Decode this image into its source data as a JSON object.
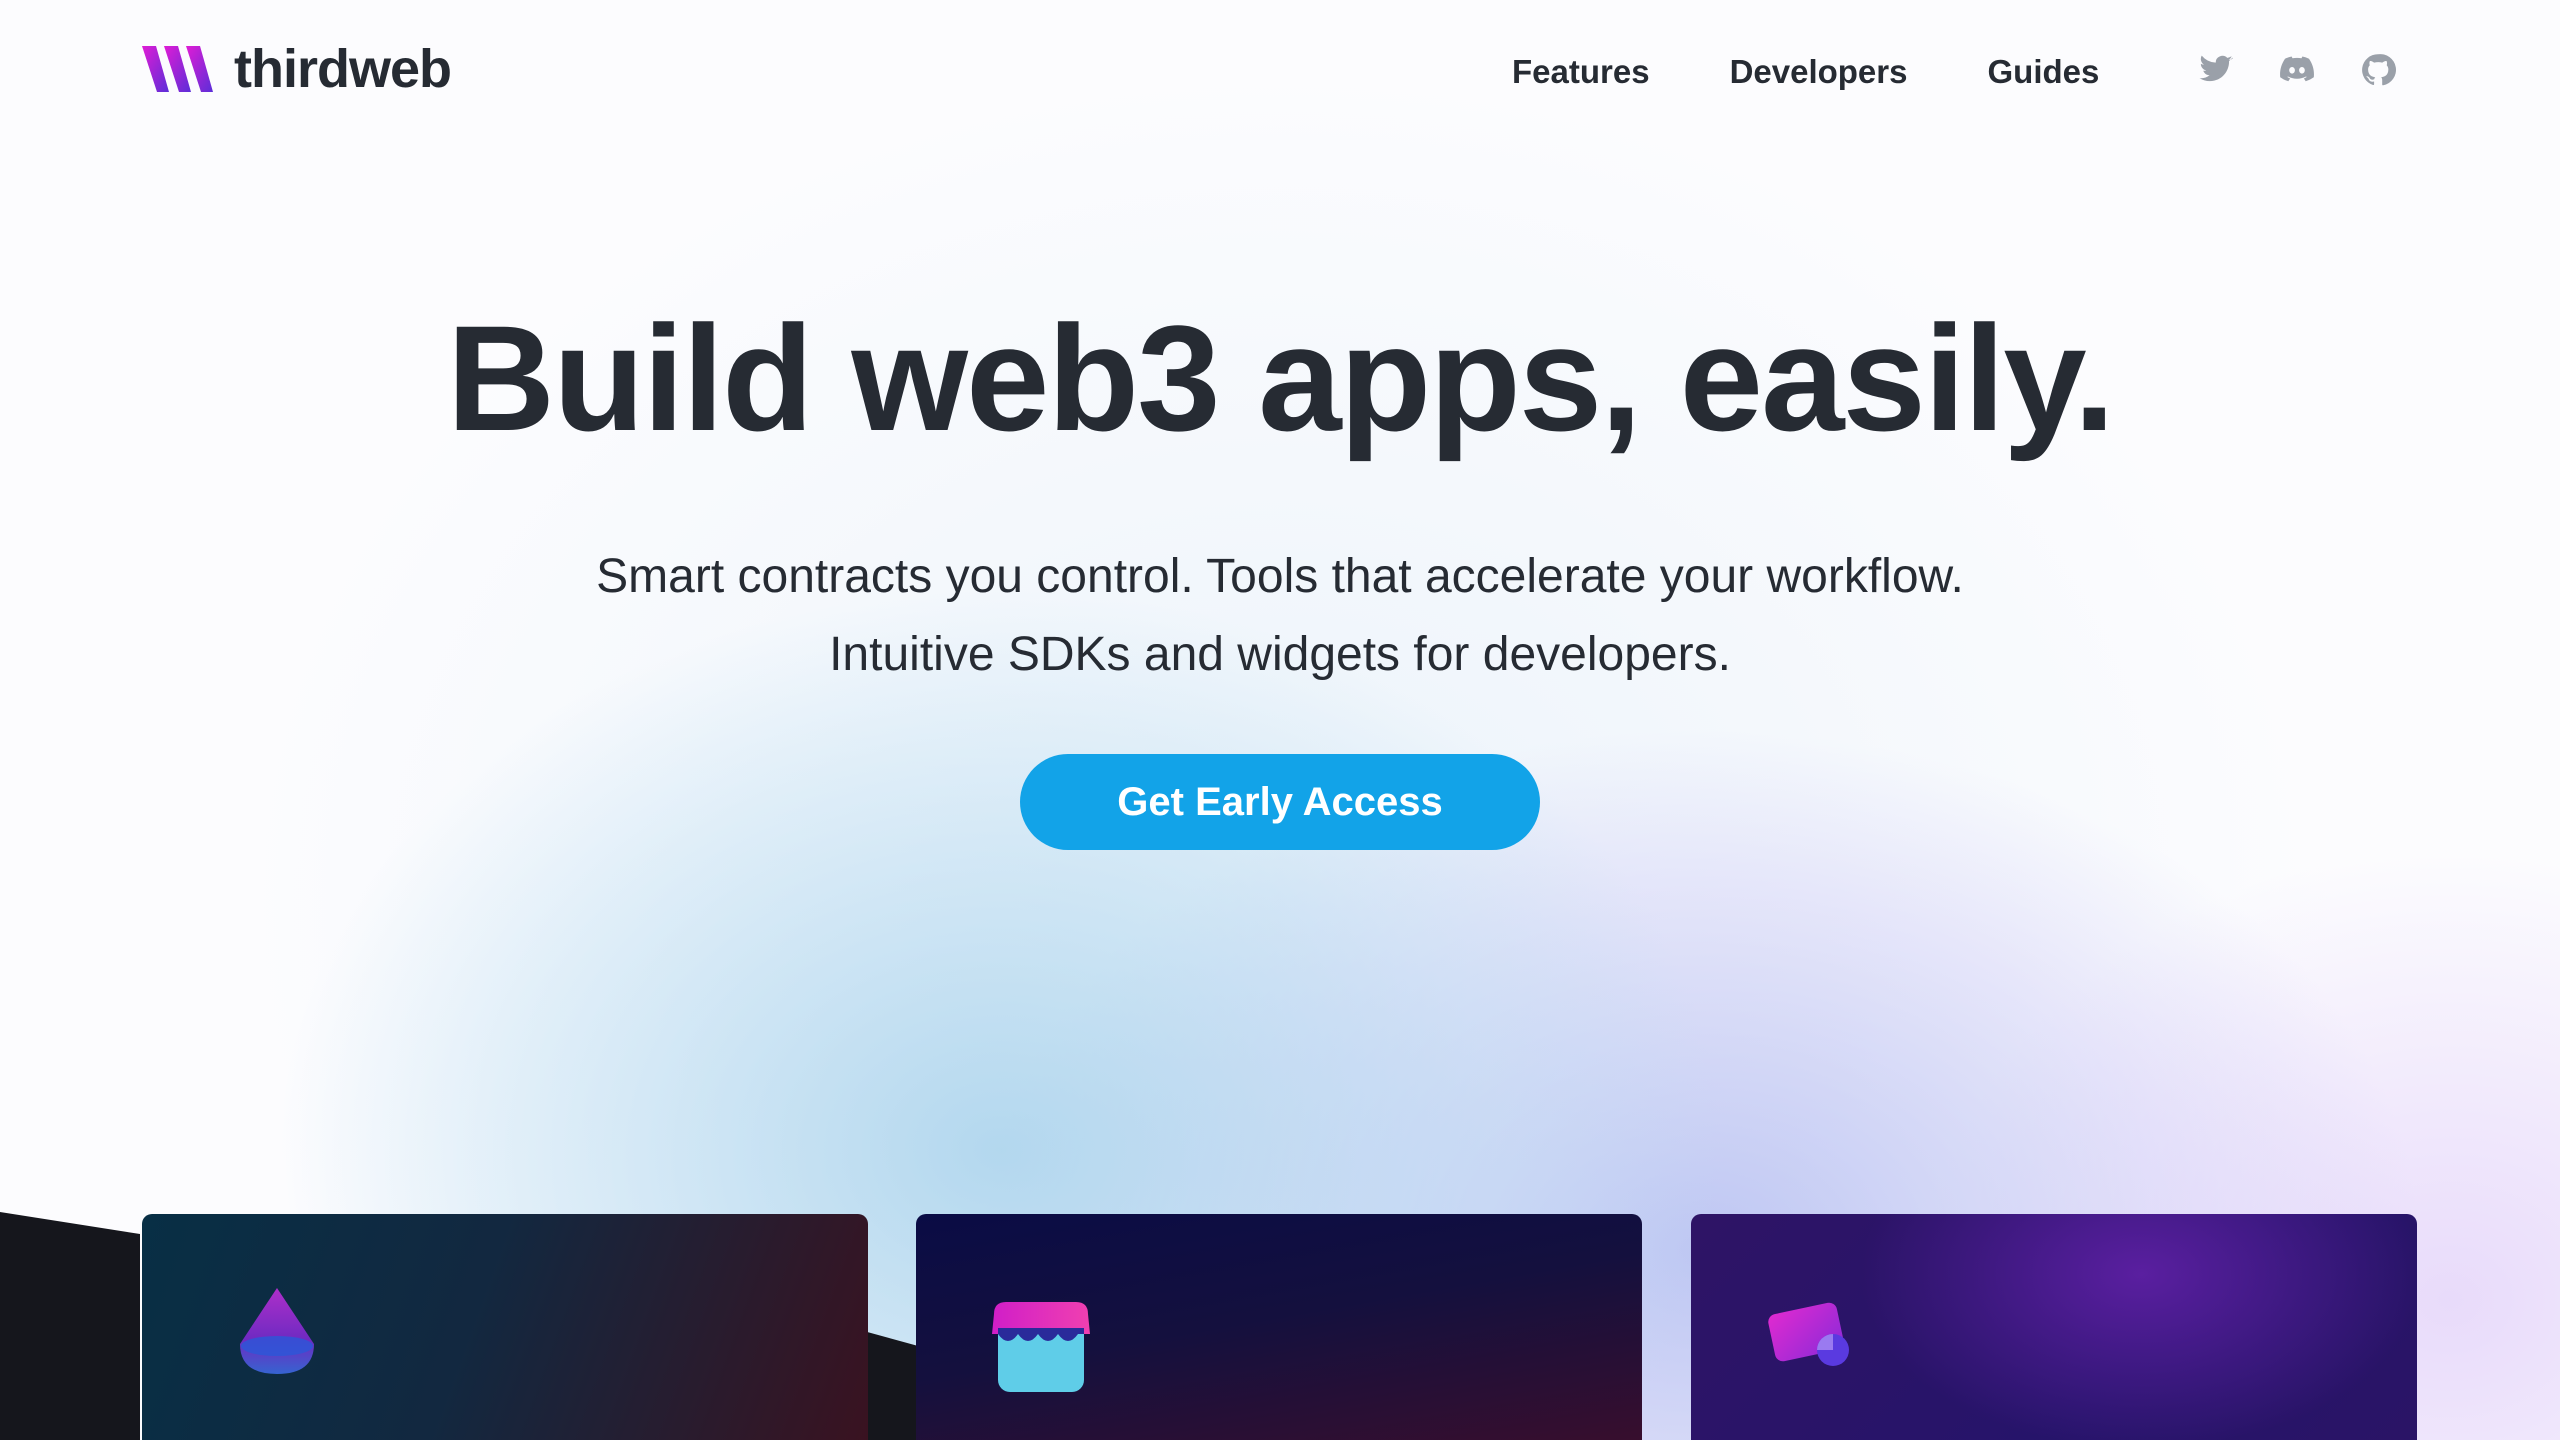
{
  "app": {
    "brand_name": "thirdweb",
    "accent_color": "#12a3e8",
    "brand_gradient": [
      "#e01cd5",
      "#5b2ed8"
    ]
  },
  "nav": {
    "items": [
      {
        "label": "Features"
      },
      {
        "label": "Developers"
      },
      {
        "label": "Guides"
      }
    ],
    "social": [
      {
        "icon": "twitter-icon"
      },
      {
        "icon": "discord-icon"
      },
      {
        "icon": "github-icon"
      }
    ]
  },
  "hero": {
    "title": "Build web3 apps, easily.",
    "subtitle_line1": "Smart contracts you control. Tools that accelerate your workflow.",
    "subtitle_line2": "Intuitive SDKs and widgets for developers.",
    "cta_label": "Get Early Access"
  },
  "cards": [
    {
      "icon": "drop-cone-icon"
    },
    {
      "icon": "storefront-icon"
    },
    {
      "icon": "payment-card-icon"
    }
  ]
}
